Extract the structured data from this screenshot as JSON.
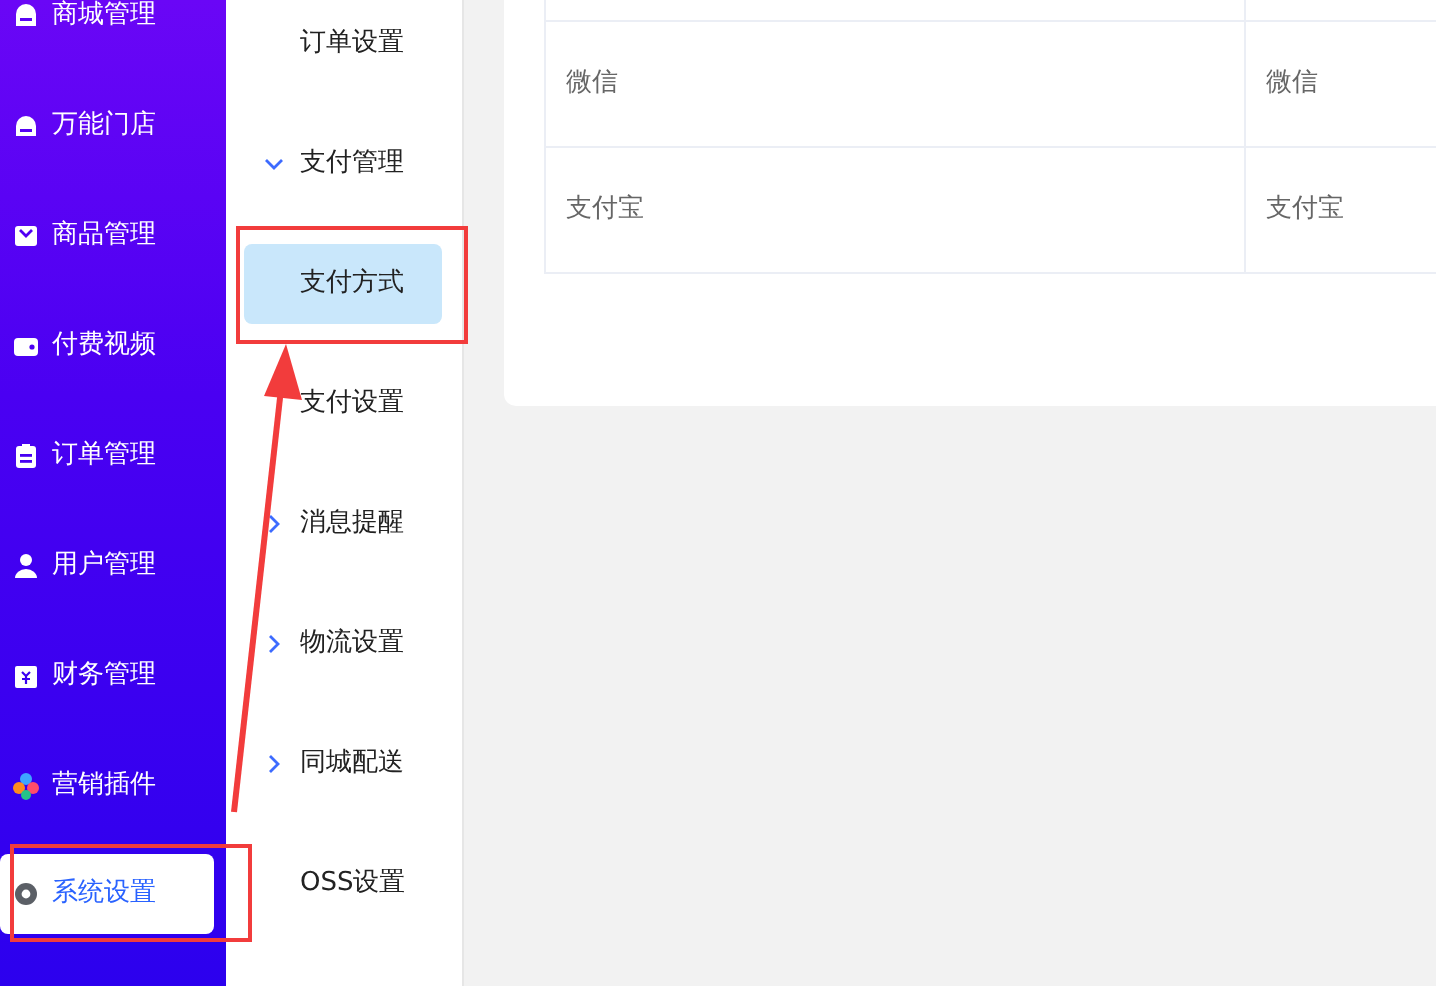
{
  "sidebar": {
    "items": [
      {
        "label": "商城管理",
        "selected": false
      },
      {
        "label": "万能门店",
        "selected": false
      },
      {
        "label": "商品管理",
        "selected": false
      },
      {
        "label": "付费视频",
        "selected": false
      },
      {
        "label": "订单管理",
        "selected": false
      },
      {
        "label": "用户管理",
        "selected": false
      },
      {
        "label": "财务管理",
        "selected": false
      },
      {
        "label": "营销插件",
        "selected": false
      },
      {
        "label": "系统设置",
        "selected": true
      }
    ]
  },
  "submenu": {
    "items": [
      {
        "kind": "link",
        "label": "订单设置",
        "selected": false
      },
      {
        "kind": "group",
        "label": "支付管理",
        "selected": false,
        "expanded": true,
        "children": [
          {
            "kind": "link",
            "label": "支付方式",
            "selected": true
          },
          {
            "kind": "link",
            "label": "支付设置",
            "selected": false
          }
        ]
      },
      {
        "kind": "group",
        "label": "消息提醒",
        "selected": false,
        "expanded": false
      },
      {
        "kind": "group",
        "label": "物流设置",
        "selected": false,
        "expanded": false
      },
      {
        "kind": "group",
        "label": "同城配送",
        "selected": false,
        "expanded": false
      },
      {
        "kind": "link",
        "label": "OSS设置",
        "selected": false
      }
    ]
  },
  "table": {
    "rows": [
      [
        "微信",
        "微信"
      ],
      [
        "支付宝",
        "支付宝"
      ]
    ]
  }
}
